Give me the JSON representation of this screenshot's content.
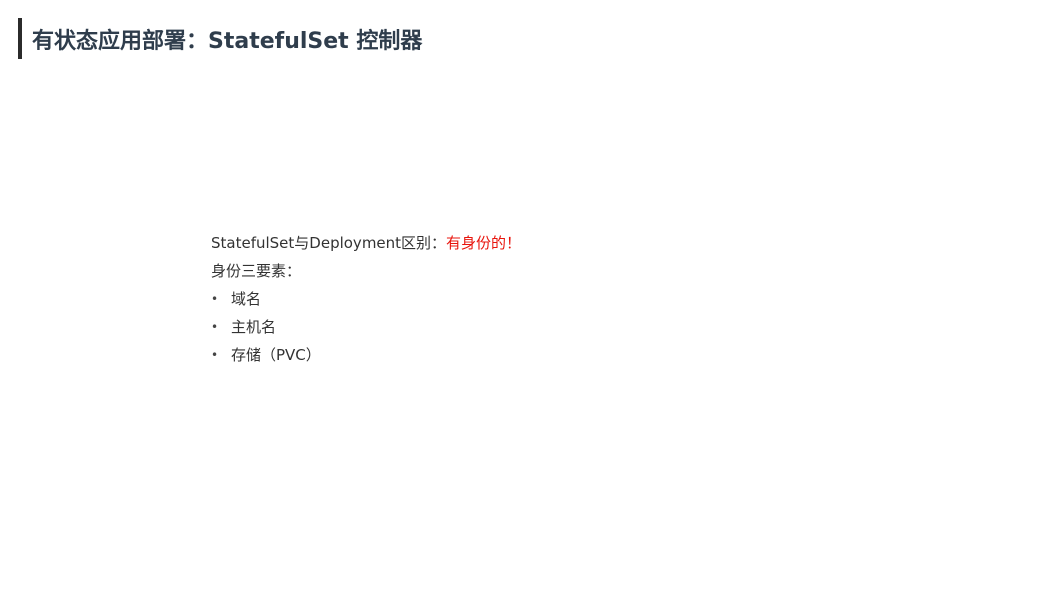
{
  "header": {
    "title": "有状态应用部署：StatefulSet 控制器"
  },
  "content": {
    "intro_prefix": "StatefulSet与Deployment区别：",
    "intro_highlight": "有身份的！",
    "subheading": "身份三要素：",
    "items": [
      {
        "label": "域名"
      },
      {
        "label": "主机名"
      },
      {
        "label": "存储（PVC）"
      }
    ],
    "bullet_glyph": "•",
    "highlight_color": "#e8140c"
  }
}
